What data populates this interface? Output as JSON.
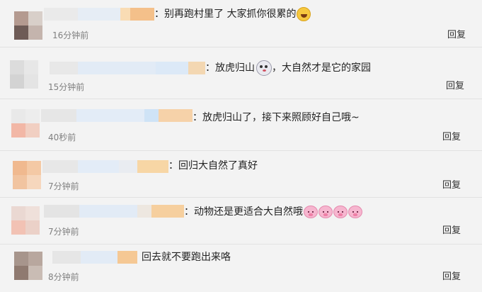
{
  "colors": {
    "background": "#f3f3f3",
    "divider": "#e2e2e2",
    "time_text": "#808080",
    "comment_text": "#222222"
  },
  "comments": [
    {
      "text": "：别再跑村里了 大家抓你很累的",
      "emoji": "laughing-face-emoji",
      "time": "16分钟前",
      "reply_label": "回复"
    },
    {
      "text": "：放虎归山",
      "emoji": "husky-face-emoji",
      "text_after": "，大自然才是它的家园",
      "time": "15分钟前",
      "reply_label": "回复"
    },
    {
      "text": "：放虎归山了，接下来照顾好自己哦~",
      "time": "40秒前",
      "reply_label": "回复"
    },
    {
      "text": "：回归大自然了真好",
      "time": "7分钟前",
      "reply_label": "回复"
    },
    {
      "text": "：动物还是更适合大自然哦",
      "emoji": "pig-face-emoji",
      "emoji_count": 4,
      "time": "7分钟前",
      "reply_label": "回复"
    },
    {
      "text": "回去就不要跑出来咯",
      "time": "8分钟前",
      "reply_label": "回复"
    }
  ]
}
